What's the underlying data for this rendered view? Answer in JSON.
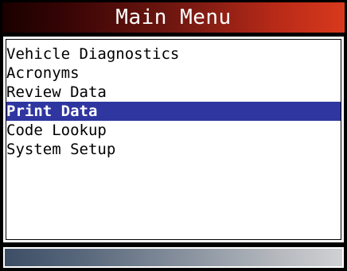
{
  "header": {
    "title": "Main Menu"
  },
  "menu": {
    "items": [
      {
        "label": "Vehicle Diagnostics",
        "selected": false
      },
      {
        "label": "Acronyms",
        "selected": false
      },
      {
        "label": "Review Data",
        "selected": false
      },
      {
        "label": "Print Data",
        "selected": true
      },
      {
        "label": "Code Lookup",
        "selected": false
      },
      {
        "label": "System Setup",
        "selected": false
      }
    ],
    "selected_index": 3
  },
  "colors": {
    "title_gradient_start": "#1a0000",
    "title_gradient_end": "#d8391d",
    "selection_highlight": "#2f36a0",
    "status_gradient_start": "#3c4e66",
    "status_gradient_end": "#cfd1d3"
  }
}
